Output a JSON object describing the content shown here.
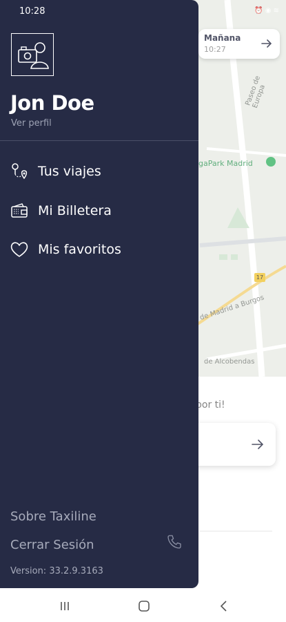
{
  "status_bar": {
    "time": "10:28"
  },
  "map": {
    "labels": {
      "park": "gaPark Madrid",
      "street_1": "Paseo de Europa",
      "street_2": "de Madrid a Burgos",
      "street_3": "de Alcobendas",
      "road": "17"
    }
  },
  "schedule": {
    "title": "Mañana",
    "time": "10:27"
  },
  "sheet": {
    "text": "por ti!"
  },
  "drawer": {
    "user_name": "Jon Doe",
    "profile_link": "Ver perfil",
    "menu": [
      {
        "label": "Tus viajes",
        "icon": "route-pin-icon"
      },
      {
        "label": "Mi Billetera",
        "icon": "wallet-icon"
      },
      {
        "label": "Mis favoritos",
        "icon": "heart-icon"
      }
    ],
    "footer": {
      "about": "Sobre Taxiline",
      "logout": "Cerrar Sesión",
      "version": "Version: 33.2.9.3163"
    }
  },
  "colors": {
    "drawer_bg": "#262b45",
    "text_primary": "#ffffff",
    "text_muted": "#a7abbb",
    "map_bg": "#e8ebe4"
  }
}
